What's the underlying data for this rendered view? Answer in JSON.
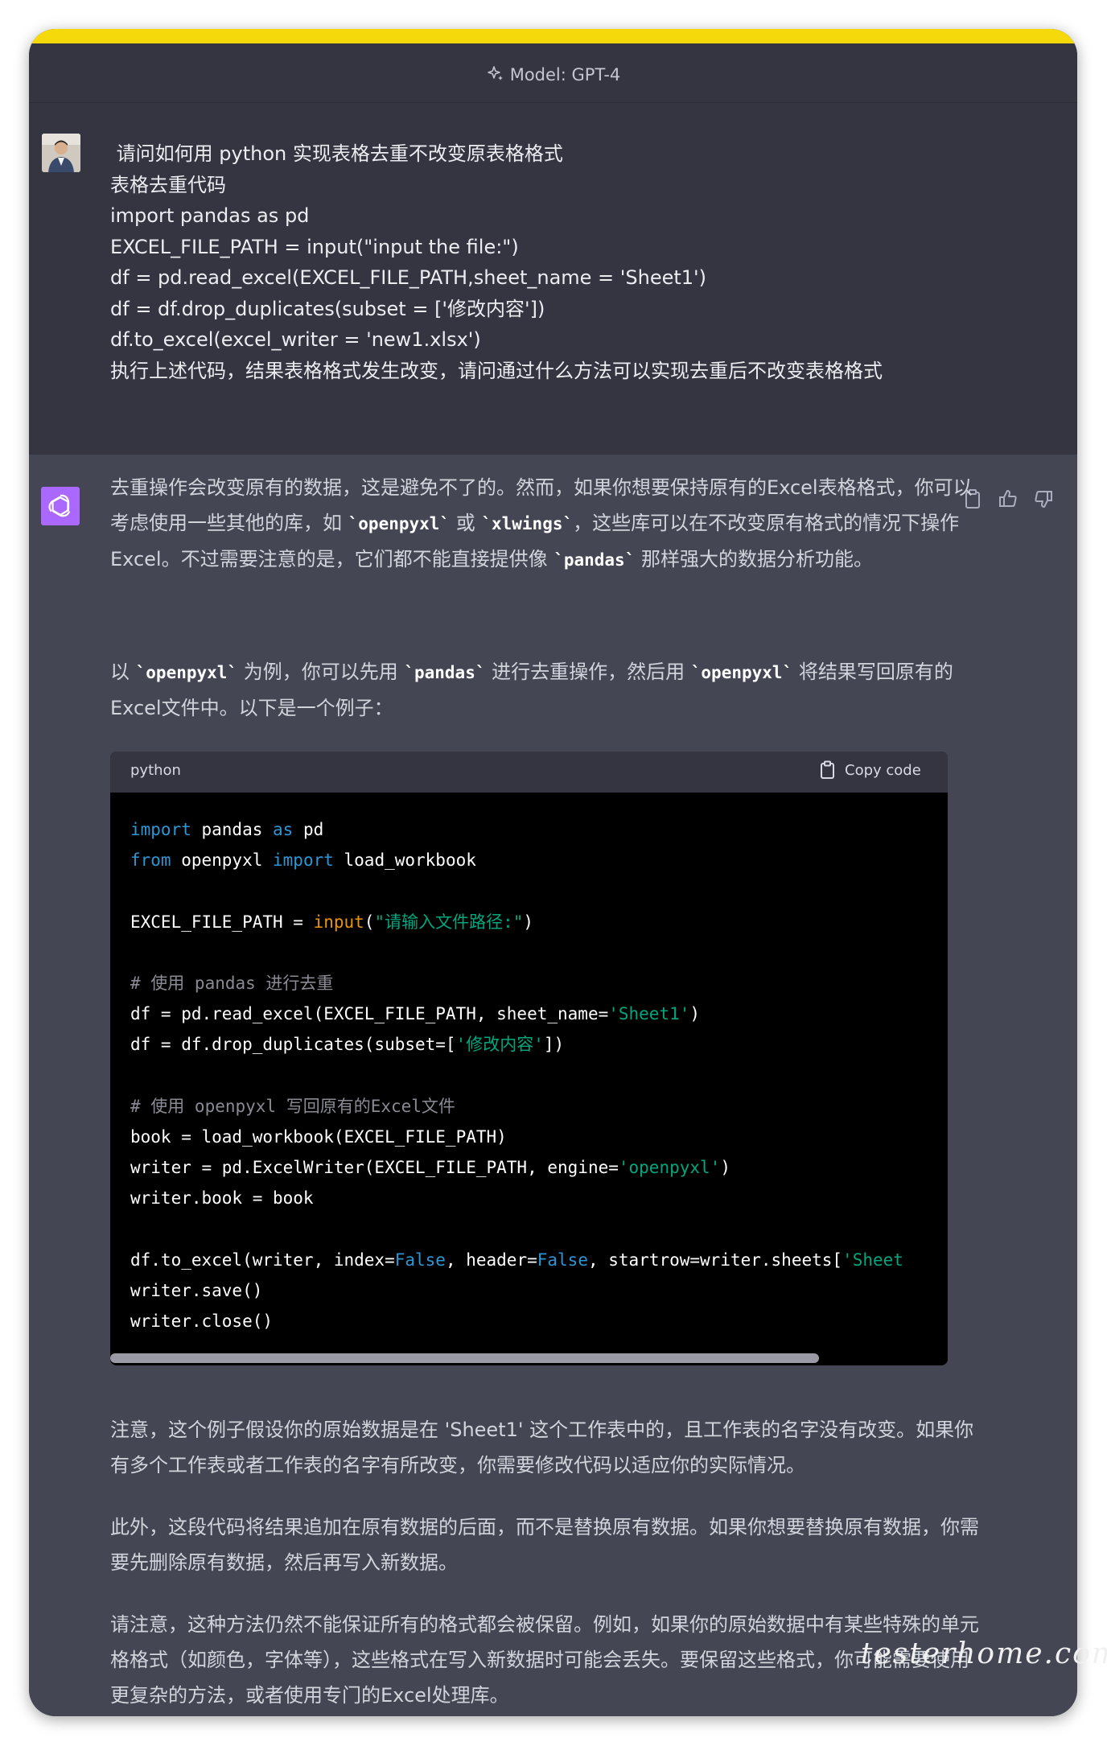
{
  "header": {
    "model_label": "Model: GPT-4"
  },
  "user_message": {
    "lines": [
      " 请问如何用 python 实现表格去重不改变原表格格式",
      "表格去重代码",
      "import pandas as pd",
      "EXCEL_FILE_PATH = input(\"input the file:\")",
      "df = pd.read_excel(EXCEL_FILE_PATH,sheet_name = 'Sheet1')",
      "df = df.drop_duplicates(subset = ['修改内容'])",
      "df.to_excel(excel_writer = 'new1.xlsx')",
      "执行上述代码，结果表格格式发生改变，请问通过什么方法可以实现去重后不改变表格格式"
    ]
  },
  "assistant": {
    "p1": {
      "t1": "去重操作会改变原有的数据，这是避免不了的。然而，如果你想要保持原有的Excel表格格式，你可以考虑使用一些其他的库，如 ",
      "c1": "`openpyxl`",
      "t2": " 或 ",
      "c2": "`xlwings`",
      "t3": "，这些库可以在不改变原有格式的情况下操作Excel。不过需要注意的是，它们都不能直接提供像 ",
      "c3": "`pandas`",
      "t4": " 那样强大的数据分析功能。"
    },
    "p2": {
      "t1": "以 ",
      "c1": "`openpyxl`",
      "t2": " 为例，你可以先用 ",
      "c2": "`pandas`",
      "t3": " 进行去重操作，然后用 ",
      "c3": "`openpyxl`",
      "t4": " 将结果写回原有的Excel文件中。以下是一个例子："
    },
    "code": {
      "language": "python",
      "copy_label": "Copy code"
    },
    "p3": "注意，这个例子假设你的原始数据是在 'Sheet1' 这个工作表中的，且工作表的名字没有改变。如果你有多个工作表或者工作表的名字有所改变，你需要修改代码以适应你的实际情况。",
    "p4": "此外，这段代码将结果追加在原有数据的后面，而不是替换原有数据。如果你想要替换原有数据，你需要先删除原有数据，然后再写入新数据。",
    "p5": "请注意，这种方法仍然不能保证所有的格式都会被保留。例如，如果你的原始数据中有某些特殊的单元格格式（如颜色，字体等），这些格式在写入新数据时可能会丢失。要保留这些格式，你可能需要使用更复杂的方法，或者使用专门的Excel处理库。"
  },
  "code_lines": [
    [
      {
        "t": "import",
        "c": "kw"
      },
      {
        "t": " pandas ",
        "c": ""
      },
      {
        "t": "as",
        "c": "kw"
      },
      {
        "t": " pd",
        "c": ""
      }
    ],
    [
      {
        "t": "from",
        "c": "kw"
      },
      {
        "t": " openpyxl ",
        "c": ""
      },
      {
        "t": "import",
        "c": "kw"
      },
      {
        "t": " load_workbook",
        "c": ""
      }
    ],
    [],
    [
      {
        "t": "EXCEL_FILE_PATH = ",
        "c": ""
      },
      {
        "t": "input",
        "c": "fn"
      },
      {
        "t": "(",
        "c": ""
      },
      {
        "t": "\"请输入文件路径:\"",
        "c": "str"
      },
      {
        "t": ")",
        "c": ""
      }
    ],
    [],
    [
      {
        "t": "# 使用 pandas 进行去重",
        "c": "cm"
      }
    ],
    [
      {
        "t": "df = pd.read_excel(EXCEL_FILE_PATH, sheet_name=",
        "c": ""
      },
      {
        "t": "'Sheet1'",
        "c": "str"
      },
      {
        "t": ")",
        "c": ""
      }
    ],
    [
      {
        "t": "df = df.drop_duplicates(subset=[",
        "c": ""
      },
      {
        "t": "'修改内容'",
        "c": "str"
      },
      {
        "t": "])",
        "c": ""
      }
    ],
    [],
    [
      {
        "t": "# 使用 openpyxl 写回原有的Excel文件",
        "c": "cm"
      }
    ],
    [
      {
        "t": "book = load_workbook(EXCEL_FILE_PATH)",
        "c": ""
      }
    ],
    [
      {
        "t": "writer = pd.ExcelWriter(EXCEL_FILE_PATH, engine=",
        "c": ""
      },
      {
        "t": "'openpyxl'",
        "c": "str"
      },
      {
        "t": ")",
        "c": ""
      }
    ],
    [
      {
        "t": "writer.book = book",
        "c": ""
      }
    ],
    [],
    [
      {
        "t": "df.to_excel(writer, index=",
        "c": ""
      },
      {
        "t": "False",
        "c": "kw"
      },
      {
        "t": ", header=",
        "c": ""
      },
      {
        "t": "False",
        "c": "kw"
      },
      {
        "t": ", startrow=writer.sheets[",
        "c": ""
      },
      {
        "t": "'Sheet",
        "c": "str"
      }
    ],
    [
      {
        "t": "writer.save()",
        "c": ""
      }
    ],
    [
      {
        "t": "writer.close()",
        "c": ""
      }
    ]
  ],
  "watermark": "testerhome.com"
}
